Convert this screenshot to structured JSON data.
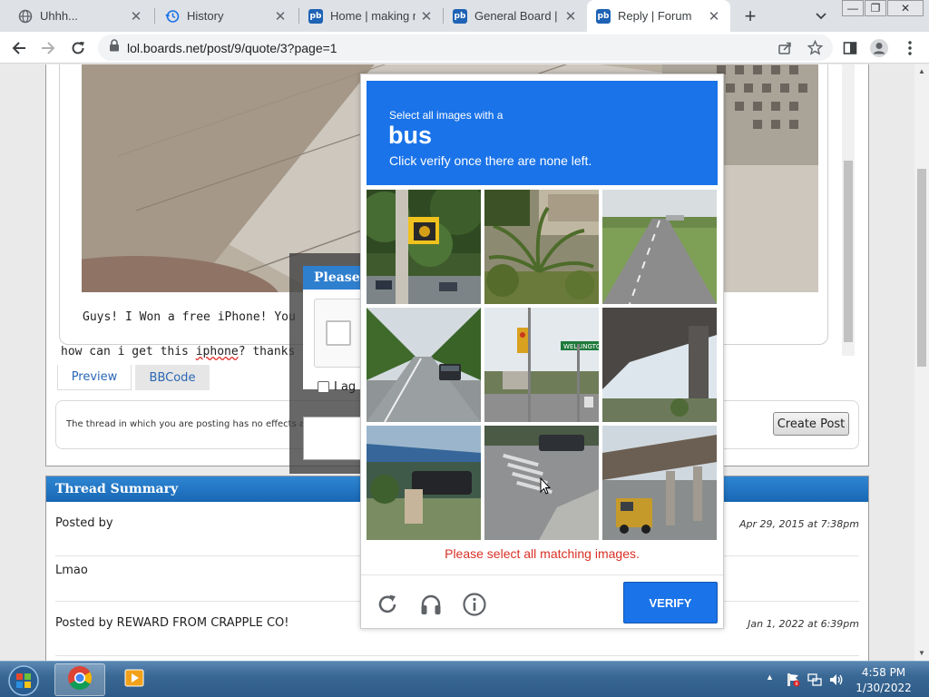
{
  "browser": {
    "tabs": [
      {
        "title": "Uhhh...",
        "icon": "globe-icon"
      },
      {
        "title": "History",
        "icon": "history-icon"
      },
      {
        "title": "Home | making m",
        "icon": "proboards-icon"
      },
      {
        "title": "General Board | F",
        "icon": "proboards-icon"
      },
      {
        "title": "Reply | Forum",
        "icon": "proboards-icon"
      }
    ],
    "active_tab": 4,
    "url": "lol.boards.net/post/9/quote/3?page=1"
  },
  "editor": {
    "quote_text": "Guys! I Won a free iPhone! You have",
    "reply_text_before": "how can i get this ",
    "reply_text_misspelt": "iphone",
    "reply_text_after": "? thanks",
    "tabs": [
      "Preview",
      "BBCode"
    ],
    "notice": "The thread in which you are posting has no effects appl",
    "create_post_label": "Create Post"
  },
  "dialog": {
    "title": "Please",
    "agree_text": "I ag"
  },
  "captcha": {
    "instruction_line1": "Select all images with a",
    "target": "bus",
    "instruction_line3": "Click verify once there are none left.",
    "tiles": [
      "traffic-light-on-pole",
      "palm-shrubs",
      "empty-road",
      "road-with-car",
      "traffic-light-intersection",
      "overpass-underside",
      "suburban-house-car",
      "crosswalk-intersection",
      "overpass-truck"
    ],
    "error": "Please select all matching images.",
    "verify_label": "VERIFY",
    "tile_sign_text": "WELLINGTON"
  },
  "summary": {
    "header": "Thread Summary",
    "rows": [
      {
        "label": "Posted by",
        "date": "Apr 29, 2015 at 7:38pm"
      },
      {
        "label": "Lmao",
        "date": ""
      },
      {
        "label": "Posted by REWARD FROM CRAPPLE CO!",
        "date": "Jan 1, 2022 at 6:39pm"
      }
    ]
  },
  "taskbar": {
    "time": "4:58 PM",
    "date": "1/30/2022"
  },
  "colors": {
    "captcha_blue": "#1a73e8",
    "error_red": "#d93025",
    "summary_header": "#1867b4"
  }
}
